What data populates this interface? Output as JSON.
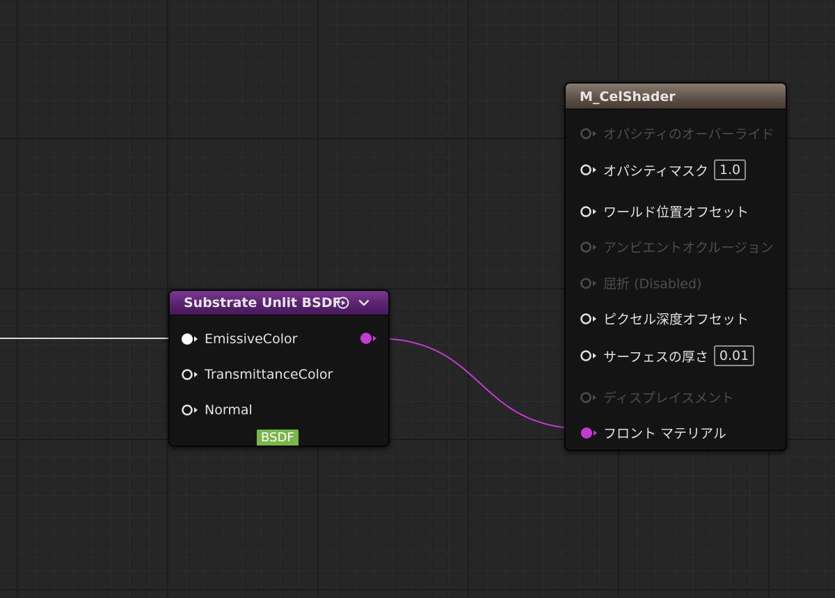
{
  "graph": {
    "wire_colors": {
      "incoming": "#d8d8d8",
      "substrate": "#c33ad1"
    }
  },
  "bsdf_node": {
    "title": "Substrate Unlit BSDF",
    "header_color": "#5a2270",
    "header_icons": [
      "play-circle-icon",
      "chevron-down-icon"
    ],
    "inputs": [
      {
        "label": "EmissiveColor",
        "connected": true
      },
      {
        "label": "TransmittanceColor",
        "connected": false
      },
      {
        "label": "Normal",
        "connected": false
      }
    ],
    "output_pin_color": "#c33ad1",
    "badge": "BSDF",
    "badge_color": "#7ab648"
  },
  "material_node": {
    "title": "M_CelShader",
    "header_color": "#5e5046",
    "inputs": [
      {
        "label": "オパシティのオーバーライド",
        "enabled": false
      },
      {
        "label": "オパシティマスク",
        "enabled": true,
        "value": "1.0"
      },
      {
        "label": "ワールド位置オフセット",
        "enabled": true
      },
      {
        "label": "アンビエントオクルージョン",
        "enabled": false
      },
      {
        "label": "屈折 (Disabled)",
        "enabled": false
      },
      {
        "label": "ピクセル深度オフセット",
        "enabled": true
      },
      {
        "label": "サーフェスの厚さ",
        "enabled": true,
        "value": "0.01"
      },
      {
        "label": "ディスプレイスメント",
        "enabled": false
      },
      {
        "label": "フロント マテリアル",
        "enabled": true,
        "connected": true
      }
    ]
  }
}
